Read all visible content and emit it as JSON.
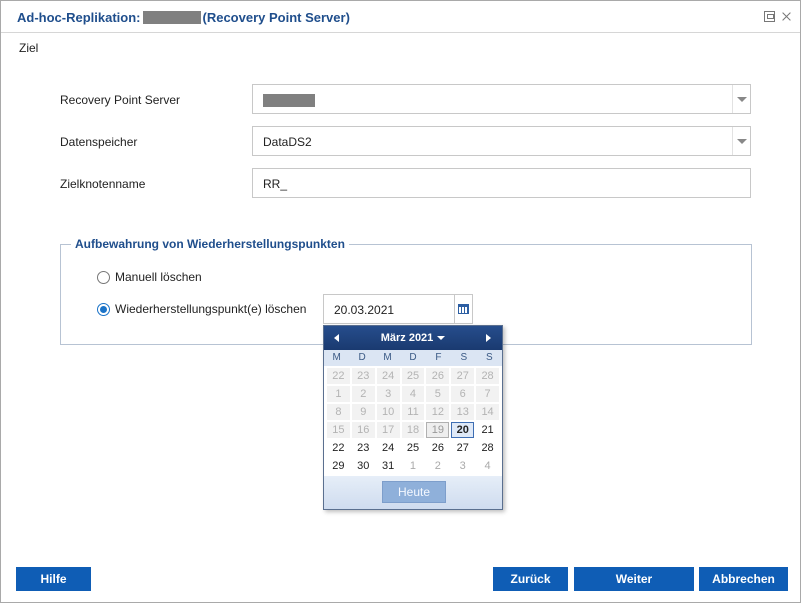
{
  "window": {
    "title_prefix": "Ad-hoc-Replikation:",
    "title_suffix": "(Recovery Point Server)"
  },
  "section": {
    "label": "Ziel"
  },
  "form": {
    "rps_label": "Recovery Point Server",
    "datastore_label": "Datenspeicher",
    "datastore_value": "DataDS2",
    "nodename_label": "Zielknotenname",
    "nodename_value": "RR_"
  },
  "retention": {
    "legend": "Aufbewahrung von Wiederherstellungspunkten",
    "manual_label": "Manuell löschen",
    "delete_label": "Wiederherstellungspunkt(e) löschen",
    "date_value": "20.03.2021"
  },
  "calendar": {
    "month_label": "März 2021",
    "weekdays": [
      "M",
      "D",
      "M",
      "D",
      "F",
      "S",
      "S"
    ],
    "weeks": [
      [
        "22",
        "23",
        "24",
        "25",
        "26",
        "27",
        "28"
      ],
      [
        "1",
        "2",
        "3",
        "4",
        "5",
        "6",
        "7"
      ],
      [
        "8",
        "9",
        "10",
        "11",
        "12",
        "13",
        "14"
      ],
      [
        "15",
        "16",
        "17",
        "18",
        "19",
        "20",
        "21"
      ],
      [
        "22",
        "23",
        "24",
        "25",
        "26",
        "27",
        "28"
      ],
      [
        "29",
        "30",
        "31",
        "1",
        "2",
        "3",
        "4"
      ]
    ],
    "today_label": "Heute"
  },
  "buttons": {
    "help": "Hilfe",
    "back": "Zurück",
    "next": "Weiter",
    "cancel": "Abbrechen"
  }
}
